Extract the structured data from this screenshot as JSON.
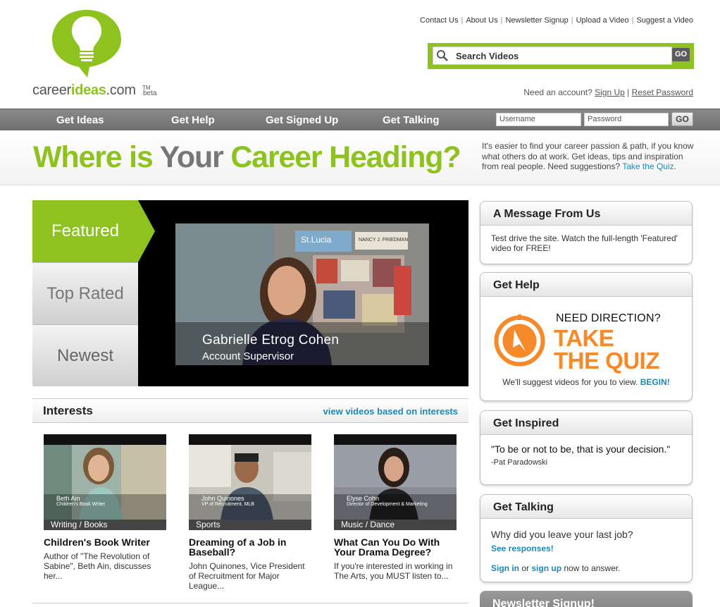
{
  "header": {
    "logo": {
      "prefix": "career",
      "brand": "ideas",
      "suffix": ".com",
      "tm": "TM",
      "beta": "beta"
    },
    "toplinks": [
      "Contact Us",
      "About Us",
      "Newsletter Signup",
      "Upload a Video",
      "Suggest a Video"
    ],
    "search": {
      "placeholder": "Search Videos",
      "go_label": "GO"
    },
    "account": {
      "prompt": "Need an account?",
      "signup": "Sign Up",
      "separator": "|",
      "reset": "Reset Password"
    }
  },
  "nav": {
    "items": [
      "Get Ideas",
      "Get Help",
      "Get Signed Up",
      "Get Talking"
    ],
    "login": {
      "username_placeholder": "Username",
      "password_placeholder": "Password",
      "go_label": "GO"
    }
  },
  "hero": {
    "title_part1": "Where is",
    "title_part2": "Your",
    "title_part3": "Career Heading?",
    "description": "It's easier to find your career passion & path, if you know what others do at work. Get ideas, tips and inspiration from real people. Need suggestions?",
    "quiz_link": "Take the Quiz",
    "period": "."
  },
  "featured": {
    "tabs": [
      "Featured",
      "Top Rated",
      "Newest"
    ],
    "active_tab": "Featured",
    "video": {
      "name": "Gabrielle Etrog Cohen",
      "role": "Account Supervisor",
      "sign_text": "St.Lucia",
      "sign_text2": "NANCY J. FRIEDMAN"
    }
  },
  "interests": {
    "title": "Interests",
    "link": "view videos based on interests",
    "cards": [
      {
        "category": "Writing / Books",
        "thumb_name": "Beth Ain",
        "thumb_role": "Children's Book Writer",
        "title": "Children's Book Writer",
        "description": "Author of \"The Revolution of Sabine\", Beth Ain, discusses her..."
      },
      {
        "category": "Sports",
        "thumb_name": "John Quinones",
        "thumb_role": "VP of Recruitment, MLB",
        "title": "Dreaming of a Job in Baseball?",
        "description": "John Quinones, Vice President of Recruitment for Major League..."
      },
      {
        "category": "Music / Dance",
        "thumb_name": "Elyse Cohn",
        "thumb_role": "Director of Development & Marketing",
        "title": "What Can You Do With Your Drama Degree?",
        "description": "If you're interested in working in The Arts, you MUST listen to..."
      }
    ]
  },
  "sidebar": {
    "message": {
      "title": "A Message From Us",
      "body": "Test drive the site. Watch the full-length 'Featured' video for FREE!"
    },
    "help": {
      "title": "Get Help",
      "need": "NEED DIRECTION?",
      "big1": "TAKE",
      "big2": "THE QUIZ",
      "foot": "We'll suggest videos for you to view.",
      "begin": "BEGIN!"
    },
    "inspired": {
      "title": "Get Inspired",
      "quote": "\"To be or not to be, that is your decision.\"",
      "author": "-Pat Paradowski"
    },
    "talking": {
      "title": "Get Talking",
      "question": "Why did you leave your last job?",
      "responses": "See responses!",
      "signin": "Sign in",
      "or": "or",
      "signup": "sign up",
      "tail": "now to answer."
    },
    "newsletter": {
      "title": "Newsletter Signup!"
    }
  },
  "colors": {
    "brand_green": "#8dc21f",
    "link_blue": "#1a8ab5",
    "quiz_orange": "#f6892a",
    "nav_gray": "#7c7c7c"
  }
}
